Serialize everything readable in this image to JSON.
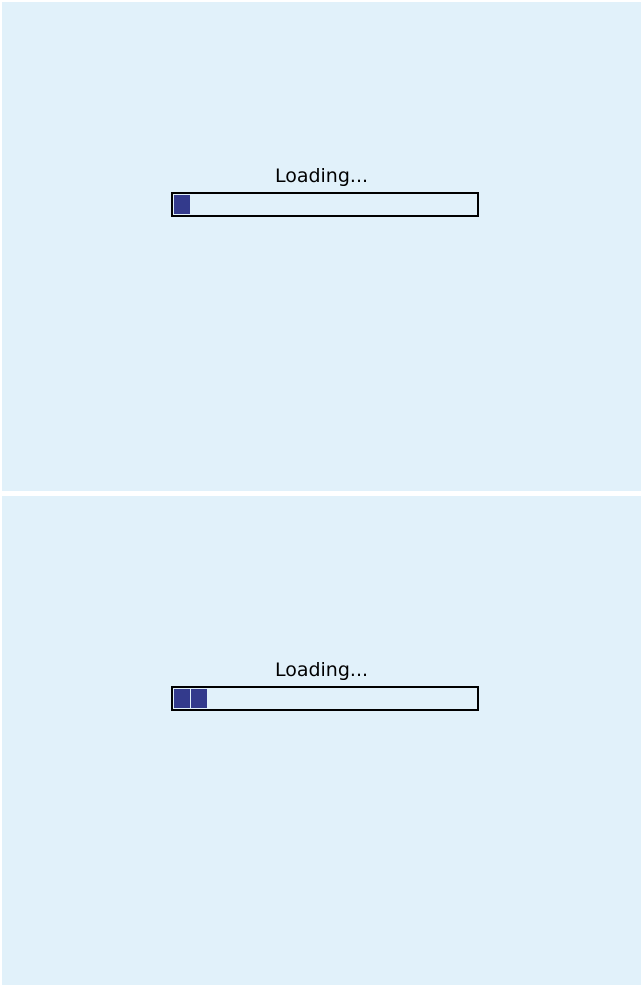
{
  "frames": [
    {
      "loading_text": "Loading...",
      "progress_blocks": 1,
      "progress_fraction": 0.055
    },
    {
      "loading_text": "Loading...",
      "progress_blocks": 2,
      "progress_fraction": 0.11
    }
  ],
  "colors": {
    "background": "#e1f1fa",
    "progress_fill": "#333a8c",
    "progress_border": "#000000",
    "text": "#000000"
  }
}
